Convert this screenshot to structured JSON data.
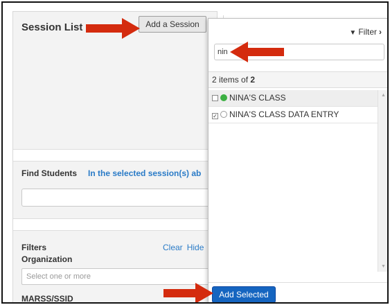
{
  "session_panel": {
    "title": "Session List",
    "add_session_label": "Add a Session"
  },
  "find_students": {
    "label": "Find Students",
    "link": "In the selected session(s) ab"
  },
  "filters": {
    "title": "Filters",
    "clear_label": "Clear",
    "hide_label": "Hide",
    "organization_label": "Organization",
    "organization_placeholder": "Select one or more",
    "marss_label": "MARSS/SSID"
  },
  "popup": {
    "filter_label": "Filter",
    "filter_icon": "funnel-icon",
    "search_value": "nin",
    "count_prefix": "2",
    "count_middle": "items of",
    "count_total": "2",
    "items": [
      {
        "label": "NINA'S CLASS",
        "checked": false,
        "status": "active",
        "status_color": "#3cb043"
      },
      {
        "label": "NINA'S CLASS DATA ENTRY",
        "checked": true,
        "status": "inactive"
      }
    ],
    "add_selected_label": "Add Selected"
  },
  "annotations": {
    "arrow_color": "#d42b0e"
  }
}
